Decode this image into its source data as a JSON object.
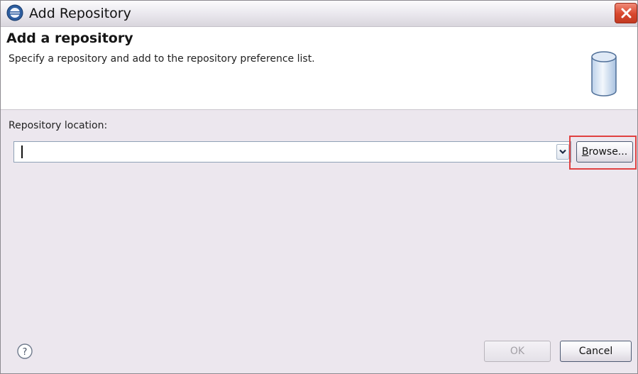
{
  "window": {
    "title": "Add Repository",
    "app_icon": "eclipse-icon",
    "close_icon": "close-icon"
  },
  "banner": {
    "title": "Add a repository",
    "description": "Specify a repository and add to the repository preference list.",
    "icon": "database-icon"
  },
  "form": {
    "location_label": "Repository location:",
    "location_value": "",
    "dropdown_icon": "chevron-down-icon",
    "browse_label_mnemonic": "B",
    "browse_label_rest": "rowse..."
  },
  "footer": {
    "help_icon": "help-icon",
    "ok_label": "OK",
    "ok_enabled": false,
    "cancel_label": "Cancel"
  },
  "colors": {
    "dialog_background": "#ece7ee",
    "banner_background": "#ffffff",
    "highlight": "#e04141",
    "close_button": "#d8472d"
  }
}
